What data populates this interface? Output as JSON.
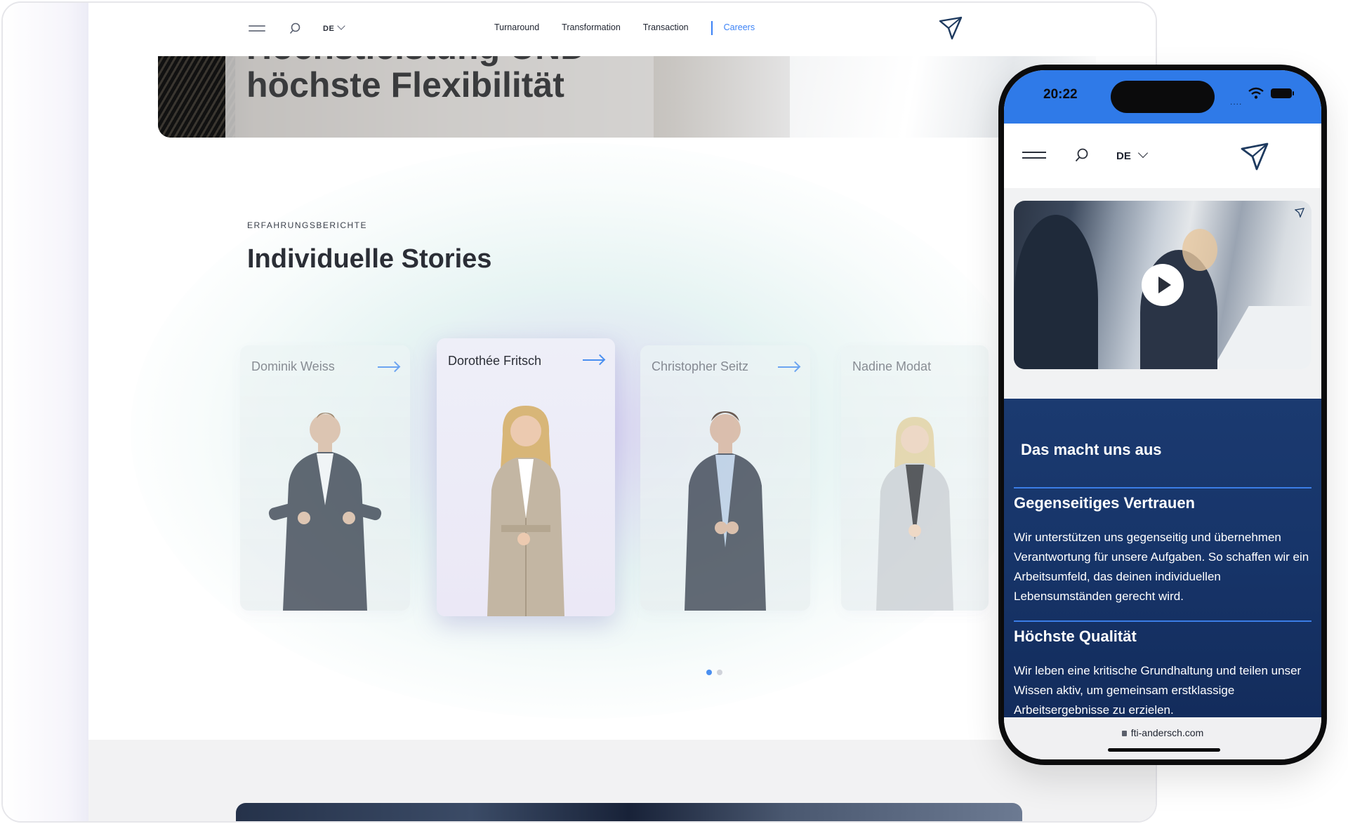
{
  "desktop": {
    "nav": {
      "menu_icon": "hamburger-icon",
      "search_icon": "search-icon",
      "language": "DE",
      "links": [
        "Turnaround",
        "Transformation",
        "Transaction",
        "Careers"
      ],
      "active_link": "Careers",
      "logo_icon": "paper-plane-logo"
    },
    "hero": {
      "title_line1": "Höchstleistung UND",
      "title_line2": "höchste Flexibilität"
    },
    "stories": {
      "eyebrow": "ERFAHRUNGSBERICHTE",
      "heading": "Individuelle Stories",
      "cards": [
        {
          "name": "Dominik Weiss"
        },
        {
          "name": "Dorothée Fritsch"
        },
        {
          "name": "Christopher Seitz"
        },
        {
          "name": "Nadine Modat"
        }
      ],
      "active_card": 1,
      "pagination": {
        "pages": 2,
        "current": 1
      }
    }
  },
  "phone": {
    "status": {
      "time": "20:22",
      "signal": "....",
      "wifi_icon": "wifi-icon",
      "battery_icon": "battery-icon"
    },
    "nav": {
      "language": "DE",
      "menu_icon": "hamburger-icon",
      "search_icon": "search-icon",
      "logo_icon": "paper-plane-logo"
    },
    "video": {
      "play_icon": "play-icon"
    },
    "values": {
      "title": "Das macht uns aus",
      "items": [
        {
          "heading": "Gegenseitiges Vertrauen",
          "text": "Wir unterstützen uns gegenseitig und übernehmen Verantwortung für unsere Aufgaben. So schaffen wir ein Arbeitsumfeld, das deinen individuellen Lebensumständen gerecht wird."
        },
        {
          "heading": "Höchste Qualität",
          "text": "Wir leben eine kritische Grundhaltung und teilen unser Wissen aktiv, um gemeinsam erstklassige Arbeitsergebnisse zu erzielen."
        }
      ]
    },
    "url": "fti-andersch.com"
  },
  "colors": {
    "accent": "#3b82f6",
    "phone_status": "#2f7ae8",
    "phone_panel": "#17356a",
    "text_dark": "#2b2e36"
  }
}
